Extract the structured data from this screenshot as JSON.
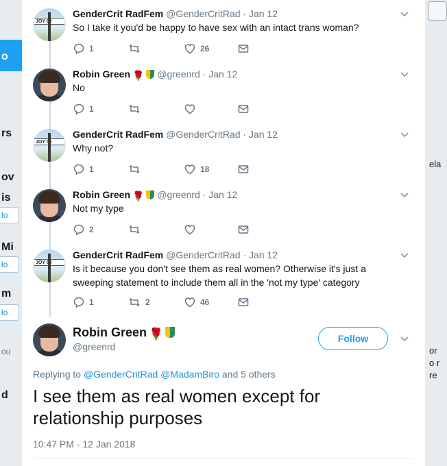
{
  "background": {
    "left_fragments": [
      "o",
      "rs",
      "ov",
      "is",
      "lo",
      "Mi",
      "lo",
      "m",
      "lo",
      "ou",
      "d"
    ],
    "right_fragments": [
      "ela",
      "or",
      "o r",
      "re"
    ]
  },
  "tweets": [
    {
      "name": "GenderCrit RadFem",
      "handle": "@GenderCritRad",
      "date": "· Jan 12",
      "text": "So I take it you'd be happy to have sex with an intact trans woman?",
      "reply_count": "1",
      "retweet_count": "",
      "like_count": "26",
      "avatar_plate": "JOY   GI"
    },
    {
      "name": "Robin Green",
      "handle": "@greenrd",
      "date": "· Jan 12",
      "text": "No",
      "reply_count": "1",
      "retweet_count": "",
      "like_count": ""
    },
    {
      "name": "GenderCrit RadFem",
      "handle": "@GenderCritRad",
      "date": "· Jan 12",
      "text": "Why not?",
      "reply_count": "1",
      "retweet_count": "",
      "like_count": "18",
      "avatar_plate": "JOY   GI"
    },
    {
      "name": "Robin Green",
      "handle": "@greenrd",
      "date": "· Jan 12",
      "text": "Not my type",
      "reply_count": "2",
      "retweet_count": "",
      "like_count": ""
    },
    {
      "name": "GenderCrit RadFem",
      "handle": "@GenderCritRad",
      "date": "· Jan 12",
      "text": "Is it because you don't see them as real women? Otherwise it's just a sweeping statement to include them all in the 'not my type' category",
      "reply_count": "1",
      "retweet_count": "2",
      "like_count": "46",
      "avatar_plate": "JOY   GI"
    }
  ],
  "main_tweet": {
    "name": "Robin Green",
    "handle": "@greenrd",
    "follow_label": "Follow",
    "replying_prefix": "Replying to",
    "mention_1": "@GenderCritRad",
    "mention_2": "@MadamBiro",
    "replying_suffix": "and 5 others",
    "text": "I see them as real women except for relationship purposes",
    "timestamp": "10:47 PM - 12 Jan 2018"
  },
  "colors": {
    "accent": "#1da1f2",
    "like_rose": "#e0245e",
    "muted": "#657786"
  }
}
